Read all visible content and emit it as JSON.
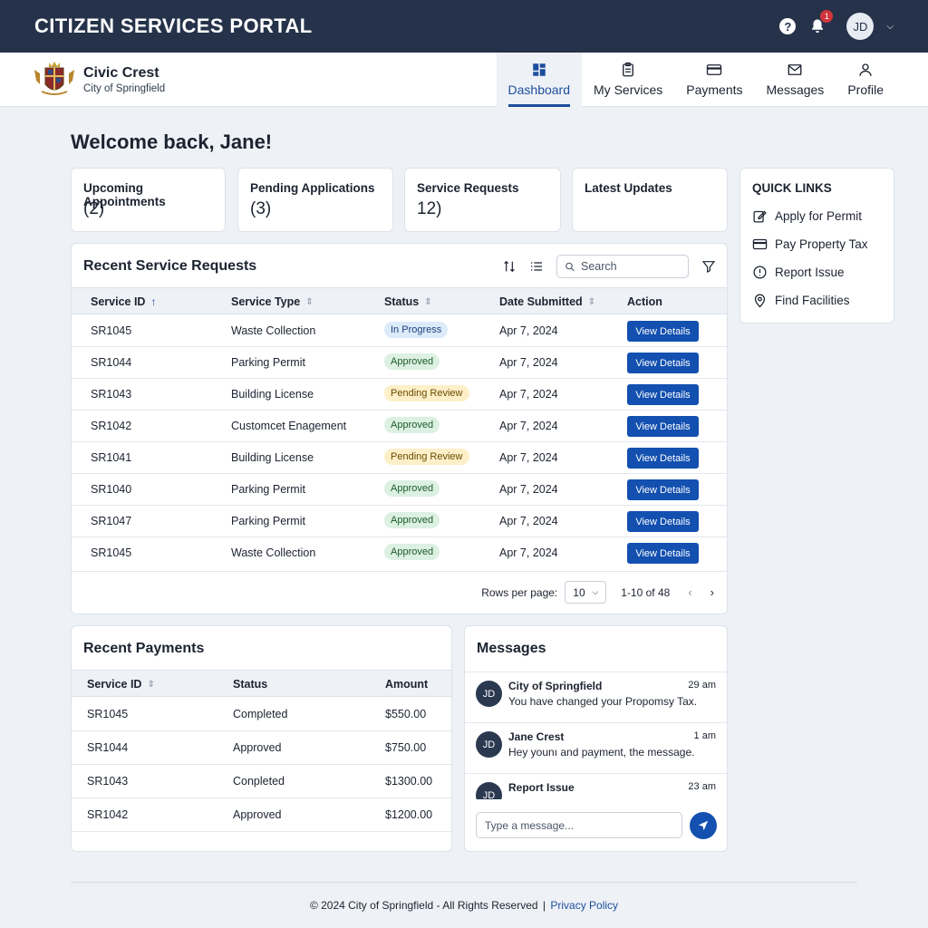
{
  "header": {
    "title": "CITIZEN SERVICES PORTAL",
    "notification_count": "1",
    "user_initials": "JD"
  },
  "brand": {
    "name": "Civic Crest",
    "subtitle": "City of Springfield"
  },
  "nav": [
    {
      "label": "Dashboard",
      "icon": "dashboard-icon",
      "active": true
    },
    {
      "label": "My Services",
      "icon": "clipboard-icon"
    },
    {
      "label": "Payments",
      "icon": "credit-card-icon"
    },
    {
      "label": "Messages",
      "icon": "envelope-icon"
    },
    {
      "label": "Profile",
      "icon": "user-icon"
    }
  ],
  "welcome": "Welcome back, Jane!",
  "stats": [
    {
      "label": "Upcoming Appointments",
      "value": "(2)"
    },
    {
      "label": "Pending Applications",
      "value": "(3)"
    },
    {
      "label": "Service Requests",
      "value": "12)"
    },
    {
      "label": "Latest Updates",
      "value": ""
    }
  ],
  "quick_links": {
    "title": "QUICK LINKS",
    "items": [
      {
        "label": "Apply for Permit",
        "icon": "edit-icon"
      },
      {
        "label": "Pay Property Tax",
        "icon": "card-icon"
      },
      {
        "label": "Report Issue",
        "icon": "alert-icon"
      },
      {
        "label": "Find Facilities",
        "icon": "location-pin-icon"
      }
    ]
  },
  "service_requests": {
    "title": "Recent Service Requests",
    "search_placeholder": "Search",
    "columns": [
      "Service ID",
      "Service Type",
      "Status",
      "Date Submitted",
      "Action"
    ],
    "rows": [
      {
        "id": "SR1045",
        "type": "Waste Collection",
        "status": "In Progress",
        "status_kind": "inprogress",
        "date": "Apr 7, 2024",
        "action": "View Details"
      },
      {
        "id": "SR1044",
        "type": "Parking Permit",
        "status": "Approved",
        "status_kind": "approved",
        "date": "Apr 7, 2024",
        "action": "View Details"
      },
      {
        "id": "SR1043",
        "type": "Building License",
        "status": "Pending Review",
        "status_kind": "pending",
        "date": "Apr 7, 2024",
        "action": "View Details"
      },
      {
        "id": "SR1042",
        "type": "Customcet Enagement",
        "status": "Approved",
        "status_kind": "approved",
        "date": "Apr 7, 2024",
        "action": "View Details"
      },
      {
        "id": "SR1041",
        "type": "Building License",
        "status": "Pending Review",
        "status_kind": "pending",
        "date": "Apr 7, 2024",
        "action": "View Details"
      },
      {
        "id": "SR1040",
        "type": "Parking Permit",
        "status": "Approved",
        "status_kind": "approved",
        "date": "Apr 7, 2024",
        "action": "View Details"
      },
      {
        "id": "SR1047",
        "type": "Parking Permit",
        "status": "Approved",
        "status_kind": "approved",
        "date": "Apr 7, 2024",
        "action": "View Details"
      },
      {
        "id": "SR1045",
        "type": "Waste Collection",
        "status": "Approved",
        "status_kind": "approved",
        "date": "Apr 7, 2024",
        "action": "View Details"
      }
    ],
    "pagination": {
      "rows_label": "Rows per page:",
      "rows_value": "10",
      "range": "1-10 of 48"
    }
  },
  "payments": {
    "title": "Recent Payments",
    "columns": [
      "Service ID",
      "Status",
      "Amount"
    ],
    "rows": [
      {
        "id": "SR1045",
        "status": "Completed",
        "amount": "$550.00"
      },
      {
        "id": "SR1044",
        "status": "Approved",
        "amount": "$750.00"
      },
      {
        "id": "SR1043",
        "status": "Conpleted",
        "amount": "$1300.00"
      },
      {
        "id": "SR1042",
        "status": "Approved",
        "amount": "$1200.00"
      }
    ]
  },
  "messages": {
    "title": "Messages",
    "items": [
      {
        "initials": "JD",
        "sender": "City of Springfield",
        "time": "29 am",
        "text": "You have changed your Propomsy Tax."
      },
      {
        "initials": "JD",
        "sender": "Jane Crest",
        "time": "1 am",
        "text": "Hey younı and payment, the message."
      },
      {
        "initials": "JD",
        "sender": "Report Issue",
        "time": "23 am",
        "text": ""
      }
    ],
    "input_placeholder": "Type a message..."
  },
  "footer": {
    "copyright": "© 2024 City of Springfield - All Rights Reserved",
    "separator": "|",
    "privacy_link": "Privacy Policy"
  },
  "colors": {
    "header_bg": "#25324a",
    "accent": "#1350b0",
    "approved_bg": "#dcf1e1",
    "pending_bg": "#fdefc8",
    "inprogress_bg": "#dcebfa",
    "badge_red": "#d0363c"
  }
}
